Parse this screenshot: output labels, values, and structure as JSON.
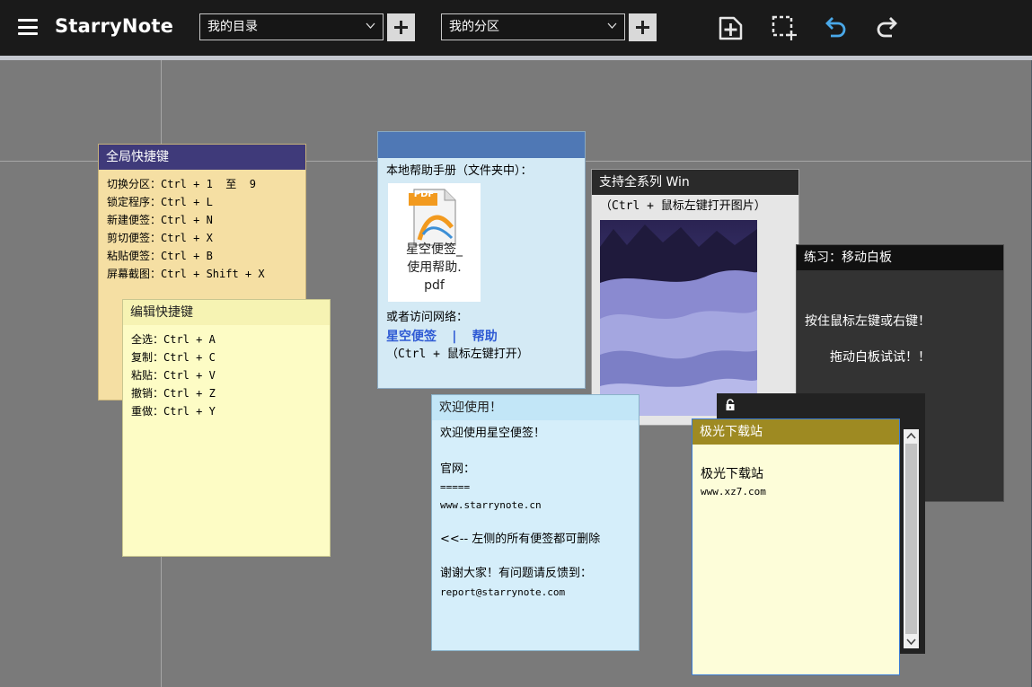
{
  "app": {
    "title": "StarryNote"
  },
  "toolbar": {
    "directory_select": {
      "value": "我的目录"
    },
    "section_select": {
      "value": "我的分区"
    },
    "icons": [
      "menu-icon",
      "new-note-icon",
      "screenshot-icon",
      "undo-icon",
      "redo-icon"
    ]
  },
  "colors": {
    "topbar": "#1a1a1a",
    "canvas": "#7a7a7a",
    "undo_accent": "#4aa8e8"
  },
  "notes": {
    "global_shortcuts": {
      "title": "全局快捷键",
      "lines": [
        "切换分区：Ctrl + 1  至  9",
        "锁定程序：Ctrl + L",
        "新建便签：Ctrl + N",
        "剪切便签：Ctrl + X",
        "粘贴便签：Ctrl + B",
        "屏幕截图：Ctrl + Shift + X"
      ]
    },
    "edit_shortcuts": {
      "title": "编辑快捷键",
      "lines": [
        "全选：Ctrl + A",
        "复制：Ctrl + C",
        "粘贴：Ctrl + V",
        "撤销：Ctrl + Z",
        "重做：Ctrl + Y"
      ]
    },
    "help": {
      "title": "",
      "intro": "本地帮助手册（文件夹中）：",
      "pdf_badge": "PDF",
      "pdf_name_1": "星空便签_",
      "pdf_name_2": "使用帮助.",
      "pdf_name_3": "pdf",
      "web_label": "或者访问网络：",
      "link_starry": "星空便签",
      "link_sep": "|",
      "link_help": "帮助",
      "hint": "（Ctrl + 鼠标左键打开）"
    },
    "image": {
      "title": "支持全系列 Win",
      "hint": "（Ctrl + 鼠标左键打开图片）"
    },
    "whiteboard": {
      "title": "练习：移动白板",
      "line1": "按住鼠标左键或右键！",
      "line2": "拖动白板试试！！"
    },
    "welcome": {
      "title": "欢迎使用！",
      "l1": "欢迎使用星空便签！",
      "l2": "官网：",
      "l3": "=====",
      "l4": "www.starrynote.cn",
      "l5": "<<-- 左侧的所有便签都可删除",
      "l6": "谢谢大家！有问题请反馈到：",
      "l7": "report@starrynote.com"
    },
    "xz7": {
      "title": "极光下载站",
      "l1": "极光下载站",
      "l2": "www.xz7.com"
    }
  }
}
